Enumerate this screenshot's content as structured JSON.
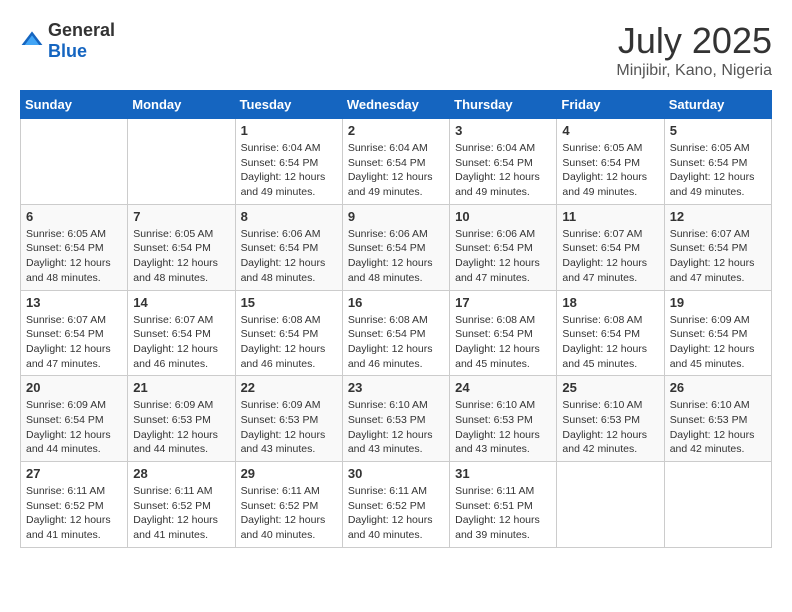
{
  "header": {
    "logo_general": "General",
    "logo_blue": "Blue",
    "month": "July 2025",
    "location": "Minjibir, Kano, Nigeria"
  },
  "weekdays": [
    "Sunday",
    "Monday",
    "Tuesday",
    "Wednesday",
    "Thursday",
    "Friday",
    "Saturday"
  ],
  "weeks": [
    [
      {
        "day": "",
        "sunrise": "",
        "sunset": "",
        "daylight": ""
      },
      {
        "day": "",
        "sunrise": "",
        "sunset": "",
        "daylight": ""
      },
      {
        "day": "1",
        "sunrise": "Sunrise: 6:04 AM",
        "sunset": "Sunset: 6:54 PM",
        "daylight": "Daylight: 12 hours and 49 minutes."
      },
      {
        "day": "2",
        "sunrise": "Sunrise: 6:04 AM",
        "sunset": "Sunset: 6:54 PM",
        "daylight": "Daylight: 12 hours and 49 minutes."
      },
      {
        "day": "3",
        "sunrise": "Sunrise: 6:04 AM",
        "sunset": "Sunset: 6:54 PM",
        "daylight": "Daylight: 12 hours and 49 minutes."
      },
      {
        "day": "4",
        "sunrise": "Sunrise: 6:05 AM",
        "sunset": "Sunset: 6:54 PM",
        "daylight": "Daylight: 12 hours and 49 minutes."
      },
      {
        "day": "5",
        "sunrise": "Sunrise: 6:05 AM",
        "sunset": "Sunset: 6:54 PM",
        "daylight": "Daylight: 12 hours and 49 minutes."
      }
    ],
    [
      {
        "day": "6",
        "sunrise": "Sunrise: 6:05 AM",
        "sunset": "Sunset: 6:54 PM",
        "daylight": "Daylight: 12 hours and 48 minutes."
      },
      {
        "day": "7",
        "sunrise": "Sunrise: 6:05 AM",
        "sunset": "Sunset: 6:54 PM",
        "daylight": "Daylight: 12 hours and 48 minutes."
      },
      {
        "day": "8",
        "sunrise": "Sunrise: 6:06 AM",
        "sunset": "Sunset: 6:54 PM",
        "daylight": "Daylight: 12 hours and 48 minutes."
      },
      {
        "day": "9",
        "sunrise": "Sunrise: 6:06 AM",
        "sunset": "Sunset: 6:54 PM",
        "daylight": "Daylight: 12 hours and 48 minutes."
      },
      {
        "day": "10",
        "sunrise": "Sunrise: 6:06 AM",
        "sunset": "Sunset: 6:54 PM",
        "daylight": "Daylight: 12 hours and 47 minutes."
      },
      {
        "day": "11",
        "sunrise": "Sunrise: 6:07 AM",
        "sunset": "Sunset: 6:54 PM",
        "daylight": "Daylight: 12 hours and 47 minutes."
      },
      {
        "day": "12",
        "sunrise": "Sunrise: 6:07 AM",
        "sunset": "Sunset: 6:54 PM",
        "daylight": "Daylight: 12 hours and 47 minutes."
      }
    ],
    [
      {
        "day": "13",
        "sunrise": "Sunrise: 6:07 AM",
        "sunset": "Sunset: 6:54 PM",
        "daylight": "Daylight: 12 hours and 47 minutes."
      },
      {
        "day": "14",
        "sunrise": "Sunrise: 6:07 AM",
        "sunset": "Sunset: 6:54 PM",
        "daylight": "Daylight: 12 hours and 46 minutes."
      },
      {
        "day": "15",
        "sunrise": "Sunrise: 6:08 AM",
        "sunset": "Sunset: 6:54 PM",
        "daylight": "Daylight: 12 hours and 46 minutes."
      },
      {
        "day": "16",
        "sunrise": "Sunrise: 6:08 AM",
        "sunset": "Sunset: 6:54 PM",
        "daylight": "Daylight: 12 hours and 46 minutes."
      },
      {
        "day": "17",
        "sunrise": "Sunrise: 6:08 AM",
        "sunset": "Sunset: 6:54 PM",
        "daylight": "Daylight: 12 hours and 45 minutes."
      },
      {
        "day": "18",
        "sunrise": "Sunrise: 6:08 AM",
        "sunset": "Sunset: 6:54 PM",
        "daylight": "Daylight: 12 hours and 45 minutes."
      },
      {
        "day": "19",
        "sunrise": "Sunrise: 6:09 AM",
        "sunset": "Sunset: 6:54 PM",
        "daylight": "Daylight: 12 hours and 45 minutes."
      }
    ],
    [
      {
        "day": "20",
        "sunrise": "Sunrise: 6:09 AM",
        "sunset": "Sunset: 6:54 PM",
        "daylight": "Daylight: 12 hours and 44 minutes."
      },
      {
        "day": "21",
        "sunrise": "Sunrise: 6:09 AM",
        "sunset": "Sunset: 6:53 PM",
        "daylight": "Daylight: 12 hours and 44 minutes."
      },
      {
        "day": "22",
        "sunrise": "Sunrise: 6:09 AM",
        "sunset": "Sunset: 6:53 PM",
        "daylight": "Daylight: 12 hours and 43 minutes."
      },
      {
        "day": "23",
        "sunrise": "Sunrise: 6:10 AM",
        "sunset": "Sunset: 6:53 PM",
        "daylight": "Daylight: 12 hours and 43 minutes."
      },
      {
        "day": "24",
        "sunrise": "Sunrise: 6:10 AM",
        "sunset": "Sunset: 6:53 PM",
        "daylight": "Daylight: 12 hours and 43 minutes."
      },
      {
        "day": "25",
        "sunrise": "Sunrise: 6:10 AM",
        "sunset": "Sunset: 6:53 PM",
        "daylight": "Daylight: 12 hours and 42 minutes."
      },
      {
        "day": "26",
        "sunrise": "Sunrise: 6:10 AM",
        "sunset": "Sunset: 6:53 PM",
        "daylight": "Daylight: 12 hours and 42 minutes."
      }
    ],
    [
      {
        "day": "27",
        "sunrise": "Sunrise: 6:11 AM",
        "sunset": "Sunset: 6:52 PM",
        "daylight": "Daylight: 12 hours and 41 minutes."
      },
      {
        "day": "28",
        "sunrise": "Sunrise: 6:11 AM",
        "sunset": "Sunset: 6:52 PM",
        "daylight": "Daylight: 12 hours and 41 minutes."
      },
      {
        "day": "29",
        "sunrise": "Sunrise: 6:11 AM",
        "sunset": "Sunset: 6:52 PM",
        "daylight": "Daylight: 12 hours and 40 minutes."
      },
      {
        "day": "30",
        "sunrise": "Sunrise: 6:11 AM",
        "sunset": "Sunset: 6:52 PM",
        "daylight": "Daylight: 12 hours and 40 minutes."
      },
      {
        "day": "31",
        "sunrise": "Sunrise: 6:11 AM",
        "sunset": "Sunset: 6:51 PM",
        "daylight": "Daylight: 12 hours and 39 minutes."
      },
      {
        "day": "",
        "sunrise": "",
        "sunset": "",
        "daylight": ""
      },
      {
        "day": "",
        "sunrise": "",
        "sunset": "",
        "daylight": ""
      }
    ]
  ]
}
